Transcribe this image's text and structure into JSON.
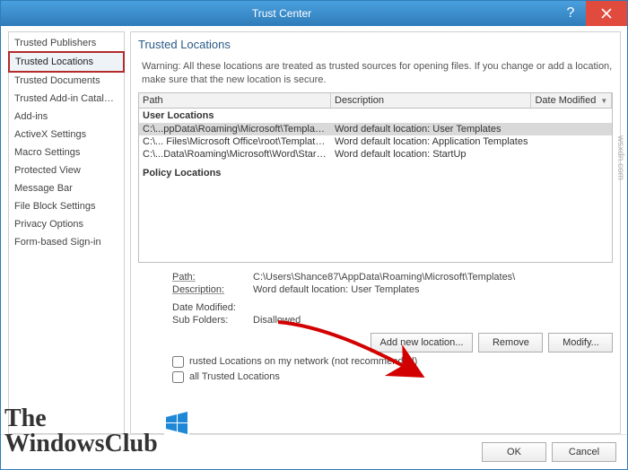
{
  "window": {
    "title": "Trust Center"
  },
  "sidebar": {
    "items": [
      "Trusted Publishers",
      "Trusted Locations",
      "Trusted Documents",
      "Trusted Add-in Catalogs",
      "Add-ins",
      "ActiveX Settings",
      "Macro Settings",
      "Protected View",
      "Message Bar",
      "File Block Settings",
      "Privacy Options",
      "Form-based Sign-in"
    ],
    "selected_index": 1
  },
  "content": {
    "heading": "Trusted Locations",
    "warning": "Warning: All these locations are treated as trusted sources for opening files. If you change or add a location, make sure that the new location is secure.",
    "columns": {
      "path": "Path",
      "desc": "Description",
      "date": "Date Modified"
    },
    "groups": {
      "user": "User Locations",
      "policy": "Policy Locations"
    },
    "rows": [
      {
        "path": "C:\\...ppData\\Roaming\\Microsoft\\Templates\\",
        "desc": "Word default location: User Templates",
        "selected": true
      },
      {
        "path": "C:\\... Files\\Microsoft Office\\root\\Templates\\",
        "desc": "Word default location: Application Templates",
        "selected": false
      },
      {
        "path": "C:\\...Data\\Roaming\\Microsoft\\Word\\Startup\\",
        "desc": "Word default location: StartUp",
        "selected": false
      }
    ],
    "details": {
      "path_label": "Path:",
      "path_value": "C:\\Users\\Shance87\\AppData\\Roaming\\Microsoft\\Templates\\",
      "desc_label": "Description:",
      "desc_value": "Word default location: User Templates",
      "date_label": "Date Modified:",
      "date_value": "",
      "sub_label": "Sub Folders:",
      "sub_value": "Disallowed"
    },
    "buttons": {
      "add": "Add new location...",
      "remove": "Remove",
      "modify": "Modify..."
    },
    "checkboxes": {
      "network": "rusted Locations on my network (not recommended)",
      "disable": "all Trusted Locations"
    }
  },
  "footer": {
    "ok": "OK",
    "cancel": "Cancel"
  },
  "watermark": {
    "line1": "The",
    "line2": "WindowsClub"
  },
  "source": "wsxdn.com"
}
